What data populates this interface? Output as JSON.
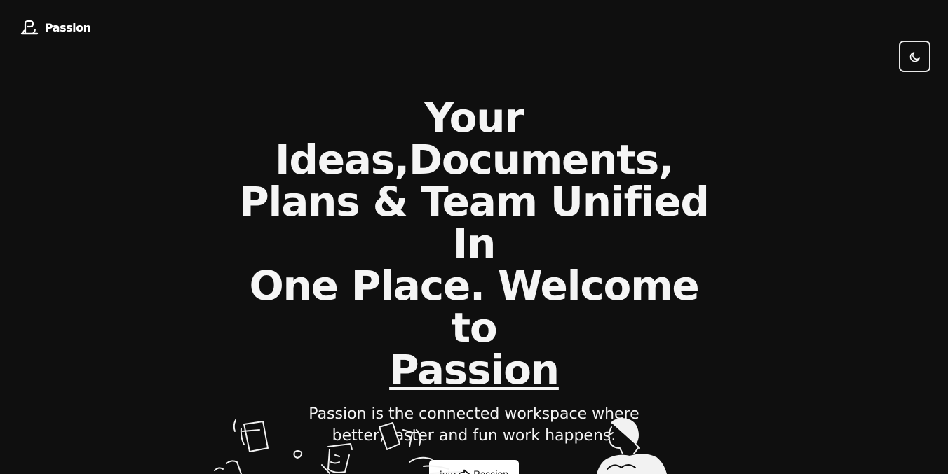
{
  "header": {
    "logo_text": "Passion",
    "logo_icon": "passion-logo-icon",
    "theme_toggle_icon": "moon-icon"
  },
  "hero": {
    "title_line1": "Your Ideas,Documents,",
    "title_line2": "Plans & Team Unified In",
    "title_line3": "One Place. Welcome to",
    "title_brand": "Passion",
    "subtitle_line1": "Passion is the connected workspace where",
    "subtitle_line2": "better, faster and fun work happens.",
    "cta_prefix": "Into",
    "cta_icon": "arrow-right-icon",
    "cta_brand": "Passion"
  },
  "colors": {
    "background": "#0f0f0f",
    "text": "#f5f5f5",
    "button_bg": "#ffffff",
    "button_text": "#111111"
  }
}
